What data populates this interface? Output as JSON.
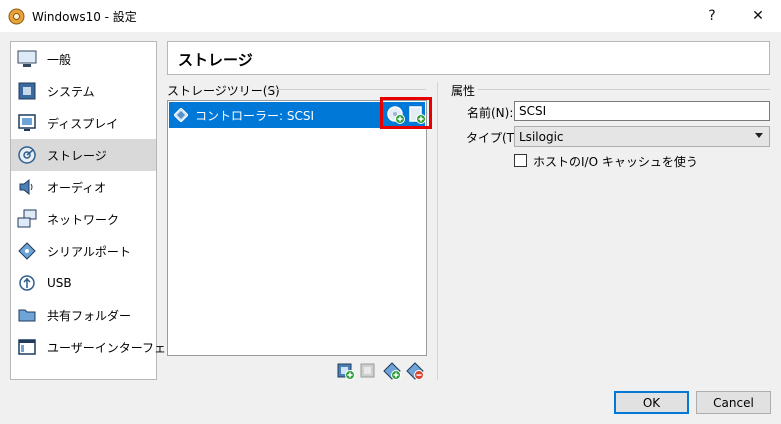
{
  "window": {
    "title": "Windows10 - 設定",
    "help": "?",
    "close": "✕"
  },
  "nav": {
    "items": [
      {
        "label": "一般",
        "icon": "general-icon"
      },
      {
        "label": "システム",
        "icon": "system-icon"
      },
      {
        "label": "ディスプレイ",
        "icon": "display-icon"
      },
      {
        "label": "ストレージ",
        "icon": "storage-icon",
        "selected": true
      },
      {
        "label": "オーディオ",
        "icon": "audio-icon"
      },
      {
        "label": "ネットワーク",
        "icon": "network-icon"
      },
      {
        "label": "シリアルポート",
        "icon": "serial-port-icon"
      },
      {
        "label": "USB",
        "icon": "usb-icon"
      },
      {
        "label": "共有フォルダー",
        "icon": "shared-folder-icon"
      },
      {
        "label": "ユーザーインターフェース",
        "icon": "user-interface-icon"
      }
    ]
  },
  "section": {
    "title": "ストレージ"
  },
  "storage_tree": {
    "label": "ストレージツリー(S)",
    "controller": "コントローラー: SCSI"
  },
  "attributes": {
    "label": "属性",
    "name_label": "名前(N):",
    "name_value": "SCSI",
    "type_label": "タイプ(T):",
    "type_value": "Lsilogic",
    "cache_label": "ホストのI/O キャッシュを使う",
    "cache_checked": false
  },
  "footer": {
    "ok": "OK",
    "cancel": "Cancel"
  },
  "colors": {
    "selection": "#0078d7",
    "highlight": "#e60000",
    "add_green": "#2e9e3a"
  }
}
